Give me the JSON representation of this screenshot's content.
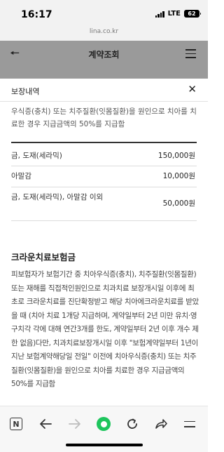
{
  "status_bar": {
    "time": "16:17",
    "network": "LTE",
    "battery": "62"
  },
  "browser": {
    "url": "lina.co.kr"
  },
  "header": {
    "title": "계약조회"
  },
  "modal": {
    "title": "보장내역",
    "summary": "우식증(충치) 또는 치주질환(잇몸질환)을 원인으로 치아를 치료한 경우 지급금액의 50%를 지급함",
    "rows": [
      {
        "label": "금, 도재(세라믹)",
        "value": "150,000원"
      },
      {
        "label": "아말감",
        "value": "10,000원"
      },
      {
        "label": "금, 도재(세라믹), 아말감 이외",
        "value": "50,000원"
      }
    ],
    "section_title": "크라운치료보험금",
    "section_body": "피보험자가 보험기간 중 치아우식증(충치), 치주질환(잇몸질환) 또는 재해를 직접적인원인으로 치과치료 보장개시일 이후에 최초로 크라운치료를 진단확정받고 해당 치아에크라운치료를 받았을 때 (치아 치료 1개당 지급하며, 계약일부터 2년 미만 유치·영구치각 각에 대해 연간3개를 한도, 계약일부터 2년 이후 개수 제한 없음)다만, 치과치료보장개시일 이후 \"보험계약일부터 1년이 지난 보험계약해당일 전일\" 이전에 치아우식증(충치) 또는 치주질환(잇몸질환)을 원인으로 치아를 치료한 경우 지급금액의 50%를 지급함"
  },
  "icons": {
    "back": "arrow-left-icon",
    "menu": "hamburger-icon",
    "close": "close-icon",
    "bottom_nav": [
      "naver-home-icon",
      "back-icon",
      "forward-icon",
      "green-dot-icon",
      "refresh-icon",
      "share-icon",
      "menu-icon"
    ]
  },
  "colors": {
    "accent_green": "#1ec55d",
    "overlay_gray": "#9a9a9a"
  }
}
